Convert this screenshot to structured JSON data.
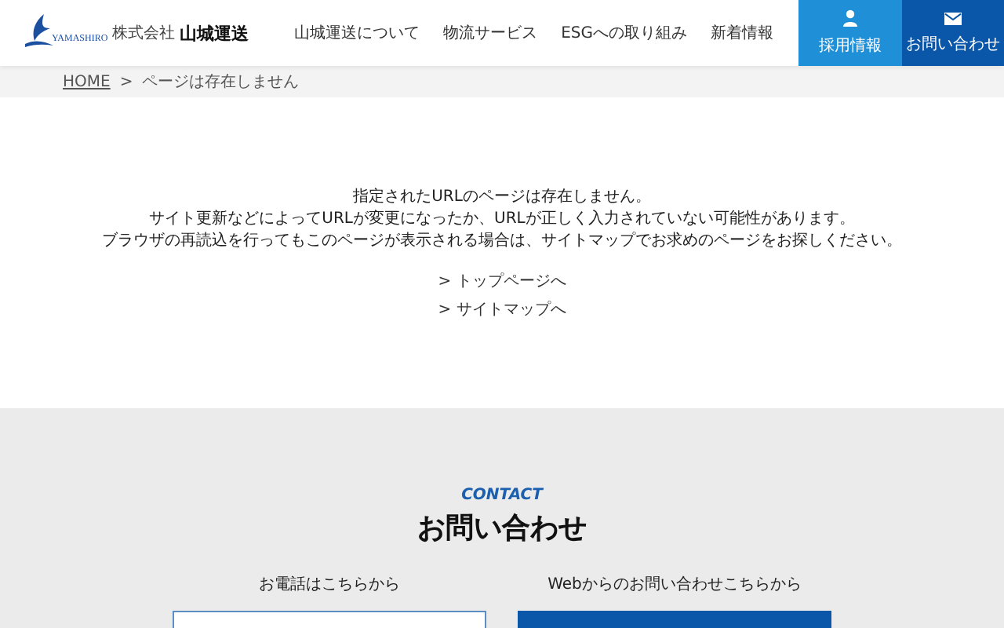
{
  "header": {
    "logo": {
      "romaji": "YAMASHIRO",
      "prefix": "株式会社",
      "name": "山城運送"
    },
    "nav": [
      "山城運送について",
      "物流サービス",
      "ESGへの取り組み",
      "新着情報"
    ],
    "actions": [
      {
        "kind": "person",
        "label": "採用情報"
      },
      {
        "kind": "mail",
        "label": "お問い合わせ"
      }
    ]
  },
  "breadcrumb": {
    "home": "HOME",
    "separator": ">",
    "current": "ページは存在しません"
  },
  "message": [
    "指定されたURLのページは存在しません。",
    "サイト更新などによってURLが変更になったか、URLが正しく入力されていない可能性があります。",
    "ブラウザの再読込を行ってもこのページが表示される場合は、サイトマップでお求めのページをお探しください。"
  ],
  "links": [
    "> トップページへ",
    "> サイトマップへ"
  ],
  "contact": {
    "eyebrow": "CONTACT",
    "title": "お問い合わせ",
    "columns": [
      {
        "kind": "phone",
        "label": "お電話はこちらから"
      },
      {
        "kind": "web",
        "label": "Webからのお問い合わせこちらから"
      }
    ]
  }
}
